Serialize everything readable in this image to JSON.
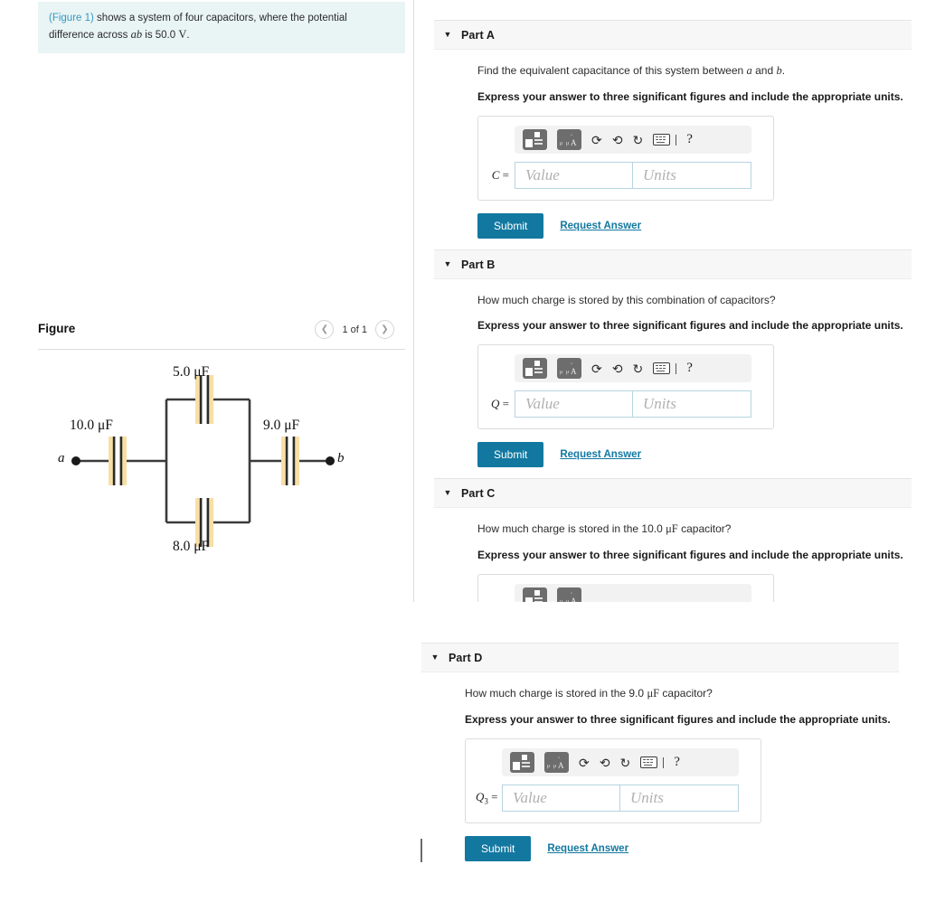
{
  "intro": {
    "figure_link": "(Figure 1)",
    "text_before_ab": " shows a system of four capacitors, where the potential difference across ",
    "ab": "ab",
    "text_after_ab": " is 50.0 ",
    "unit": "V",
    "period": "."
  },
  "figure_panel": {
    "title": "Figure",
    "prev_icon": "chevron-left-icon",
    "next_icon": "chevron-right-icon",
    "counter": "1 of 1"
  },
  "circuit": {
    "node_a_label": "a",
    "node_b_label": "b",
    "capacitors": [
      {
        "id": "c-left",
        "label": "10.0 μF",
        "value": 10.0,
        "unit": "μF",
        "position": "left-series"
      },
      {
        "id": "c-top",
        "label": "5.0 μF",
        "value": 5.0,
        "unit": "μF",
        "position": "top-parallel"
      },
      {
        "id": "c-bottom",
        "label": "8.0 μF",
        "value": 8.0,
        "unit": "μF",
        "position": "bottom-parallel"
      },
      {
        "id": "c-right",
        "label": "9.0 μF",
        "value": 9.0,
        "unit": "μF",
        "position": "right-series"
      }
    ],
    "plate_highlight_color": "#f7dfa5",
    "wire_color": "#3b3b3b"
  },
  "toolbar": {
    "template_button_1": "math-template-icon",
    "template_button_2": "units-template-icon",
    "undo_label": "←",
    "redo_label": "→",
    "reset_label": "↻",
    "keyboard_label": "keyboard-icon",
    "help_label": "?"
  },
  "common": {
    "significant_figures_instruction": "Express your answer to three significant figures and include the appropriate units.",
    "value_placeholder": "Value",
    "units_placeholder": "Units",
    "submit_label": "Submit",
    "request_answer_label": "Request Answer",
    "accent_color": "#1278a0",
    "header_bg": "#f7f7f7",
    "intro_bg": "#e9f4f4"
  },
  "parts": [
    {
      "key": "A",
      "title": "Part A",
      "prompt_pre": "Find the equivalent capacitance of this system between ",
      "prompt_var1": "a",
      "prompt_mid": " and ",
      "prompt_var2": "b",
      "prompt_post": ".",
      "instruction": "Express your answer to three significant figures and include the appropriate units.",
      "field_label": "C",
      "field_sub": "",
      "value_placeholder": "Value",
      "units_placeholder": "Units",
      "submit_label": "Submit",
      "request_answer_label": "Request Answer",
      "collapsed": false
    },
    {
      "key": "B",
      "title": "Part B",
      "prompt_pre": "How much charge is stored by this combination of capacitors?",
      "prompt_var1": "",
      "prompt_mid": "",
      "prompt_var2": "",
      "prompt_post": "",
      "instruction": "Express your answer to three significant figures and include the appropriate units.",
      "field_label": "Q",
      "field_sub": "",
      "value_placeholder": "Value",
      "units_placeholder": "Units",
      "submit_label": "Submit",
      "request_answer_label": "Request Answer",
      "collapsed": false
    },
    {
      "key": "C",
      "title": "Part C",
      "prompt_pre": "How much charge is stored in the 10.0 ",
      "prompt_unit": "μF",
      "prompt_post": " capacitor?",
      "instruction": "Express your answer to three significant figures and include the appropriate units.",
      "loading": true,
      "collapsed": false
    },
    {
      "key": "D",
      "title": "Part D",
      "prompt_pre": "How much charge is stored in the 9.0 ",
      "prompt_unit": "μF",
      "prompt_post": " capacitor?",
      "instruction": "Express your answer to three significant figures and include the appropriate units.",
      "field_label": "Q",
      "field_sub": "3",
      "value_placeholder": "Value",
      "units_placeholder": "Units",
      "submit_label": "Submit",
      "request_answer_label": "Request Answer",
      "collapsed": false
    }
  ]
}
